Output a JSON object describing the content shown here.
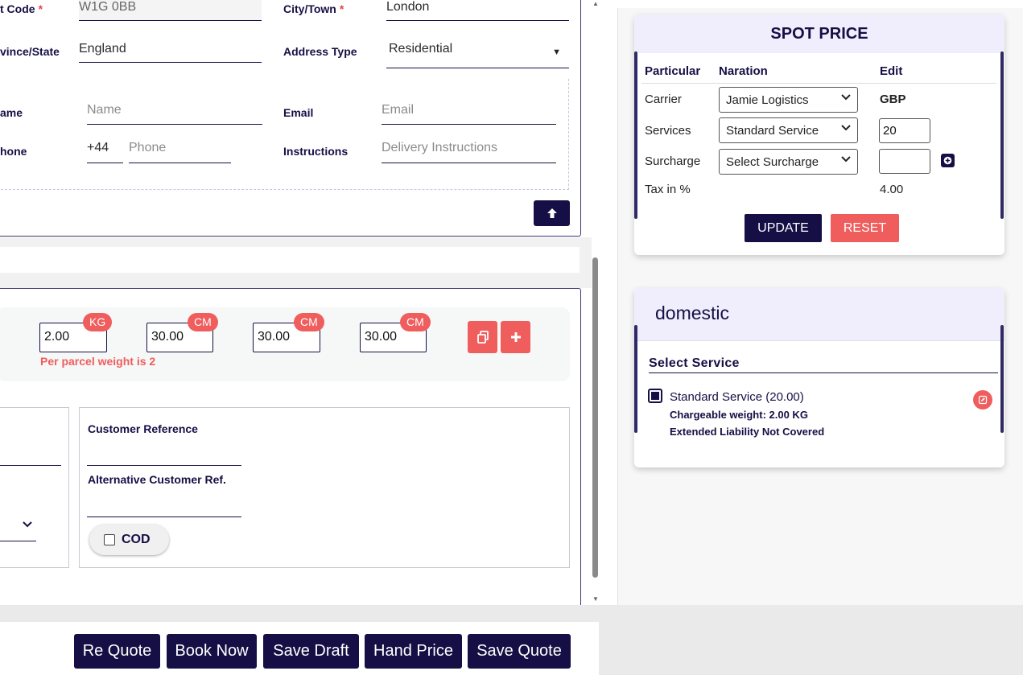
{
  "address": {
    "post_code_label": "t Code",
    "post_code_value": "W1G 0BB",
    "city_label": "City/Town",
    "city_value": "London",
    "province_label": "vince/State",
    "province_value": "England",
    "address_type_label": "Address Type",
    "address_type_value": "Residential",
    "required_mark": "*"
  },
  "contact": {
    "name_label": "ame",
    "name_placeholder": "Name",
    "email_label": "Email",
    "email_placeholder": "Email",
    "phone_label": "hone",
    "phone_code": "+44",
    "phone_placeholder": "Phone",
    "instructions_label": "Instructions",
    "instructions_placeholder": "Delivery Instructions"
  },
  "parcel": {
    "weight": "2.00",
    "weight_unit": "KG",
    "length": "30.00",
    "width": "30.00",
    "height": "30.00",
    "dim_unit": "CM",
    "error": "Per parcel weight is 2"
  },
  "references": {
    "customer_ref_label": "Customer Reference",
    "alt_ref_label": "Alternative Customer Ref.",
    "cod_label": "COD"
  },
  "footer_buttons": [
    "Re Quote",
    "Book Now",
    "Save Draft",
    "Hand Price",
    "Save Quote"
  ],
  "spot_price": {
    "title": "SPOT PRICE",
    "headers": [
      "Particular",
      "Naration",
      "Edit"
    ],
    "carrier_label": "Carrier",
    "carrier_value": "Jamie Logistics",
    "currency": "GBP",
    "services_label": "Services",
    "services_value": "Standard Service",
    "services_edit": "20",
    "surcharge_label": "Surcharge",
    "surcharge_value": "Select Surcharge",
    "tax_label": "Tax in %",
    "tax_value": "4.00",
    "update_label": "UPDATE",
    "reset_label": "RESET"
  },
  "domestic": {
    "title": "domestic",
    "section_label": "Select Service",
    "service_name": "Standard Service (20.00)",
    "chargeable": "Chargeable weight: 2.00 KG",
    "liability": "Extended Liability Not Covered"
  },
  "colors": {
    "navy": "#150f45",
    "accent_red": "#ef5d5d",
    "card_header": "#f0eefc"
  }
}
